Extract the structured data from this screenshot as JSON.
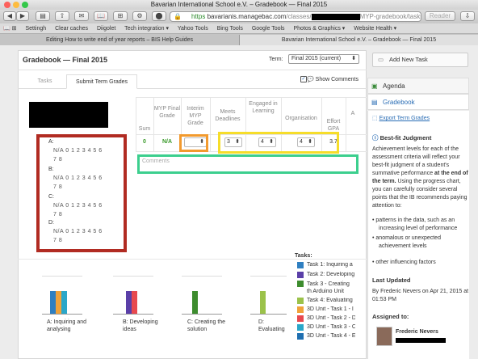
{
  "window": {
    "title": "Bavarian International School e.V. – Gradebook — Final 2015"
  },
  "toolbar": {
    "back": "◀",
    "forward": "▶",
    "sidebar": "▤",
    "share": "⇧",
    "favorites": "✉",
    "url_secure": "https",
    "url_host": "bavarianis.managebac.com",
    "url_path1": "/classes/",
    "url_path2": "MYP-gradebook/tasks/term",
    "reader": "Reader"
  },
  "bookmarks": [
    "Settingh",
    "Clear caches",
    "Diigolet",
    "Tech integration ▾",
    "Yahoo Tools",
    "Bing Tools",
    "Google Tools",
    "Photos & Graphics ▾",
    "Website Health ▾"
  ],
  "browser_tabs": [
    {
      "label": "Editing How to write end of year reports – BIS Help Guides"
    },
    {
      "label": "Bavarian International School e.V. – Gradebook — Final 2015"
    }
  ],
  "gradebook": {
    "title": "Gradebook — Final 2015",
    "term_label": "Term:",
    "term_value": "Final 2015 (current)",
    "tabs": [
      "Tasks",
      "Submit Term Grades"
    ],
    "show_comments": "Show Comments",
    "columns": {
      "sum": "Sum",
      "myp_final": "MYP Final Grade",
      "interim": "Interim MYP Grade",
      "meets": "Meets Deadlines",
      "engaged": "Engaged in Learning",
      "organisation": "Organisation",
      "effort": "Effort GPA",
      "extra": "A"
    },
    "row": {
      "sum": "0",
      "myp_final": "N/A",
      "meets": "3",
      "engaged": "4",
      "organisation": "4",
      "effort": "3.7"
    },
    "comments_placeholder": "Comments",
    "criteria": [
      {
        "label": "A:",
        "row1": "N/A   0   1   2   3   4   5   6",
        "row2": "7   8"
      },
      {
        "label": "B:",
        "row1": "N/A   0   1   2   3   4   5   6",
        "row2": "7   8"
      },
      {
        "label": "C:",
        "row1": "N/A   0   1   2   3   4   5   6",
        "row2": "7   8"
      },
      {
        "label": "D:",
        "row1": "N/A   0   1   2   3   4   5   6",
        "row2": "7   8"
      }
    ]
  },
  "charts": {
    "captions": [
      "A: Inquiring and analysing",
      "B: Developing ideas",
      "C: Creating the solution",
      "D: Evaluating"
    ],
    "tasks_title": "Tasks:",
    "legend": [
      {
        "label": "Task 1: Inquiring a",
        "color": "#2f7fc1"
      },
      {
        "label": "Task 2: Developing",
        "color": "#5a3fa8"
      },
      {
        "label": "Task 3 - Creating th Arduino Unit",
        "color": "#3d8c2e"
      },
      {
        "label": "Task 4: Evaluating",
        "color": "#9bc24a"
      },
      {
        "label": "3D Unit - Task 1 - I",
        "color": "#f0a23a"
      },
      {
        "label": "3D Unit - Task 2 - D",
        "color": "#e8494f"
      },
      {
        "label": "3D Unit - Task 3 - C",
        "color": "#2aa7c9"
      },
      {
        "label": "3D Unit - Task 4 - E",
        "color": "#1f6fb0"
      }
    ]
  },
  "sidebar": {
    "add_task": "Add New Task",
    "agenda": "Agenda",
    "gradebook": "Gradebook",
    "export": "Export Term Grades",
    "bestfit_title": "Best-fit Judgment",
    "bestfit_text1": "Achievement levels for each of the assessment criteria will reflect your best-fit judgment of a student's summative performance",
    "bestfit_bold": "at the end of the term.",
    "bestfit_text2": "Using the progress chart, you can carefully consider several points that the IB recommends paying attention to:",
    "bullets": [
      "patterns in the data, such as an increasing level of performance",
      "anomalous or unexpected achievement levels",
      "other influencing factors"
    ],
    "last_updated_title": "Last Updated",
    "last_updated_text": "By Frederic Nevers on Apr 21, 2015 at 01:53 PM",
    "assigned_title": "Assigned to:",
    "assignee": "Frederic Nevers"
  }
}
